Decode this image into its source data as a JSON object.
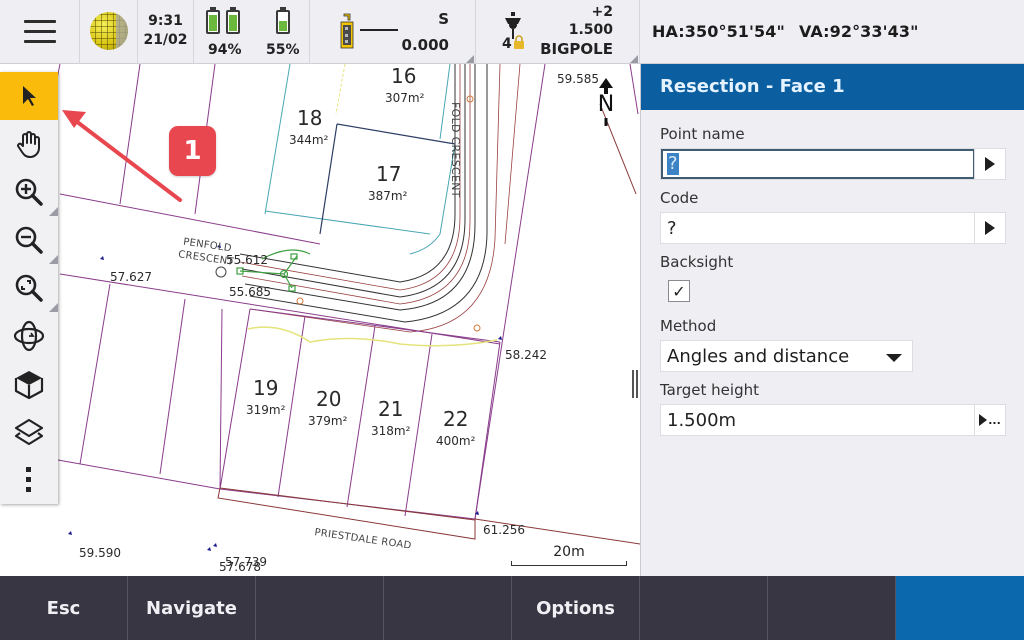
{
  "statusbar": {
    "menu_icon": "hamburger-menu-icon",
    "globe_icon": "globe-icon",
    "time": "9:31",
    "date": "21/02",
    "batteries": [
      {
        "label": "94%",
        "level_percent": 94,
        "icon": "battery-icon"
      },
      {
        "label": "55%",
        "level_percent": 55,
        "icon": "battery-icon"
      }
    ],
    "instrument": {
      "icon": "total-station-icon",
      "mode": "S",
      "value": "0.000"
    },
    "target": {
      "icon": "prism-target-icon",
      "number": "4",
      "lock_icon": "lock-icon",
      "prism_constant": "+2",
      "height": "1.500",
      "name": "BIGPOLE"
    },
    "angles": {
      "ha": "HA:350°51'54\"",
      "va": "VA:92°33'43\""
    }
  },
  "map": {
    "toolbar": [
      {
        "name": "select-tool",
        "icon": "pointer-arrow-icon",
        "active": true
      },
      {
        "name": "pan-tool",
        "icon": "hand-icon",
        "active": false
      },
      {
        "name": "zoom-in-tool",
        "icon": "zoom-in-icon",
        "active": false
      },
      {
        "name": "zoom-out-tool",
        "icon": "zoom-out-icon",
        "active": false
      },
      {
        "name": "zoom-extents-tool",
        "icon": "zoom-extents-icon",
        "active": false
      },
      {
        "name": "orbit-tool",
        "icon": "orbit-icon",
        "active": false
      },
      {
        "name": "view-cube-tool",
        "icon": "cube-icon",
        "active": false
      },
      {
        "name": "layers-tool",
        "icon": "layers-icon",
        "active": false
      },
      {
        "name": "more-tool",
        "icon": "more-vertical-icon",
        "active": false
      }
    ],
    "lots": [
      {
        "number": "16",
        "area": "307m²"
      },
      {
        "number": "18",
        "area": "344m²"
      },
      {
        "number": "17",
        "area": "387m²"
      },
      {
        "number": "19",
        "area": "319m²"
      },
      {
        "number": "20",
        "area": "379m²"
      },
      {
        "number": "21",
        "area": "318m²"
      },
      {
        "number": "22",
        "area": "400m²"
      }
    ],
    "elevations": [
      "59.585",
      "57.627",
      "55.612",
      "55.685",
      "58.242",
      "61.256",
      "59.590",
      "57.739",
      "57.678"
    ],
    "road_names": {
      "penfold_line1": "PENFOLD",
      "penfold_line2": "CRESCENT",
      "penfold_vertical": "FOLD CRESCENT",
      "priestdale": "PRIESTDALE ROAD"
    },
    "north_label": "N",
    "scale_label": "20m",
    "annotation_number": "1"
  },
  "panel": {
    "title": "Resection - Face 1",
    "point_name": {
      "label": "Point name",
      "value": "?"
    },
    "code": {
      "label": "Code",
      "value": "?"
    },
    "backsight": {
      "label": "Backsight",
      "checked": true,
      "check_glyph": "✓"
    },
    "method": {
      "label": "Method",
      "value": "Angles and distance"
    },
    "target_height": {
      "label": "Target height",
      "value": "1.500m",
      "button_glyph": "..."
    }
  },
  "bottombar": {
    "buttons": [
      "Esc",
      "Navigate",
      "",
      "",
      "Options",
      "",
      "",
      ""
    ]
  },
  "colors": {
    "accent_blue": "#0b5fa0",
    "active_tool": "#fbbb0b",
    "bottom_bar": "#383643",
    "callout": "#e8474f",
    "battery_green": "#6ab83c"
  }
}
